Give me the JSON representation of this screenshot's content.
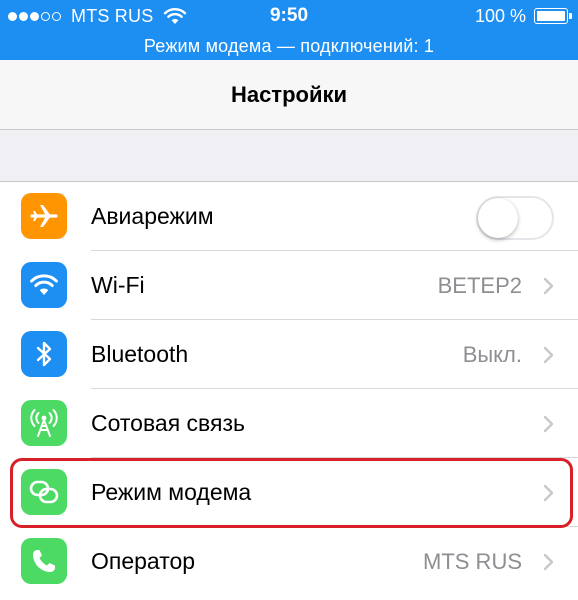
{
  "status_bar": {
    "carrier": "MTS RUS",
    "time": "9:50",
    "battery": "100 %",
    "signal_bars_filled": 3,
    "signal_bars_total": 5
  },
  "hotspot_banner": "Режим модема — подключений: 1",
  "nav": {
    "title": "Настройки"
  },
  "settings": [
    {
      "id": "airplane",
      "label": "Авиарежим",
      "icon": "airplane-icon",
      "icon_color": "#ff9500",
      "control": "toggle",
      "toggle_on": false
    },
    {
      "id": "wifi",
      "label": "Wi-Fi",
      "value": "BETEP2",
      "icon": "wifi-icon",
      "icon_color": "#1e8ff2",
      "control": "chevron"
    },
    {
      "id": "bluetooth",
      "label": "Bluetooth",
      "value": "Выкл.",
      "icon": "bluetooth-icon",
      "icon_color": "#1e8ff2",
      "control": "chevron"
    },
    {
      "id": "cellular",
      "label": "Сотовая связь",
      "icon": "cellular-antenna-icon",
      "icon_color": "#4cd964",
      "control": "chevron"
    },
    {
      "id": "hotspot",
      "label": "Режим модема",
      "icon": "personal-hotspot-icon",
      "icon_color": "#4cd964",
      "control": "chevron",
      "highlighted": true
    },
    {
      "id": "carrier",
      "label": "Оператор",
      "value": "MTS RUS",
      "icon": "phone-icon",
      "icon_color": "#4cd964",
      "control": "chevron"
    }
  ],
  "colors": {
    "accent_blue": "#1e8ff2",
    "highlight_red": "#d8202a",
    "secondary_text": "#8e8e93"
  }
}
